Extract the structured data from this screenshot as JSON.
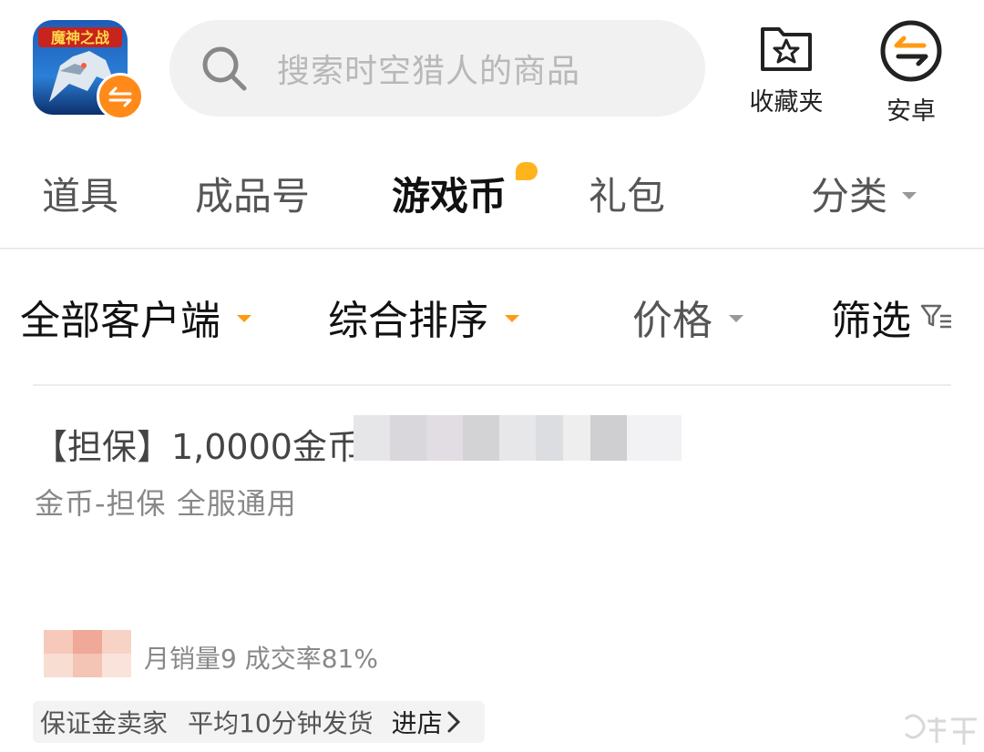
{
  "header": {
    "app_name": "魔神之战",
    "search_placeholder": "搜索时空猎人的商品",
    "favorites_label": "收藏夹",
    "platform_label": "安卓"
  },
  "tabs": [
    {
      "label": "道具"
    },
    {
      "label": "成品号"
    },
    {
      "label": "游戏币",
      "active": true
    },
    {
      "label": "礼包"
    },
    {
      "label": "分类"
    }
  ],
  "filters": {
    "client": "全部客户端",
    "sort": "综合排序",
    "price": "价格",
    "screen": "筛选"
  },
  "listing": {
    "title": "【担保】1,0000金币",
    "subtitle": "金币-担保 全服通用",
    "stats": "月销量9 成交率81%",
    "tags": {
      "deposit_seller": "保证金卖家",
      "delivery": "平均10分钟发货",
      "enter_store": "进店"
    }
  },
  "colors": {
    "accent": "#ff9b12",
    "search_bg": "#f1f1f1",
    "tag_bg": "#f3f3f3"
  },
  "icons": [
    "search-icon",
    "star-folder-icon",
    "swap-icon",
    "filter-icon",
    "chevron-right-icon"
  ]
}
